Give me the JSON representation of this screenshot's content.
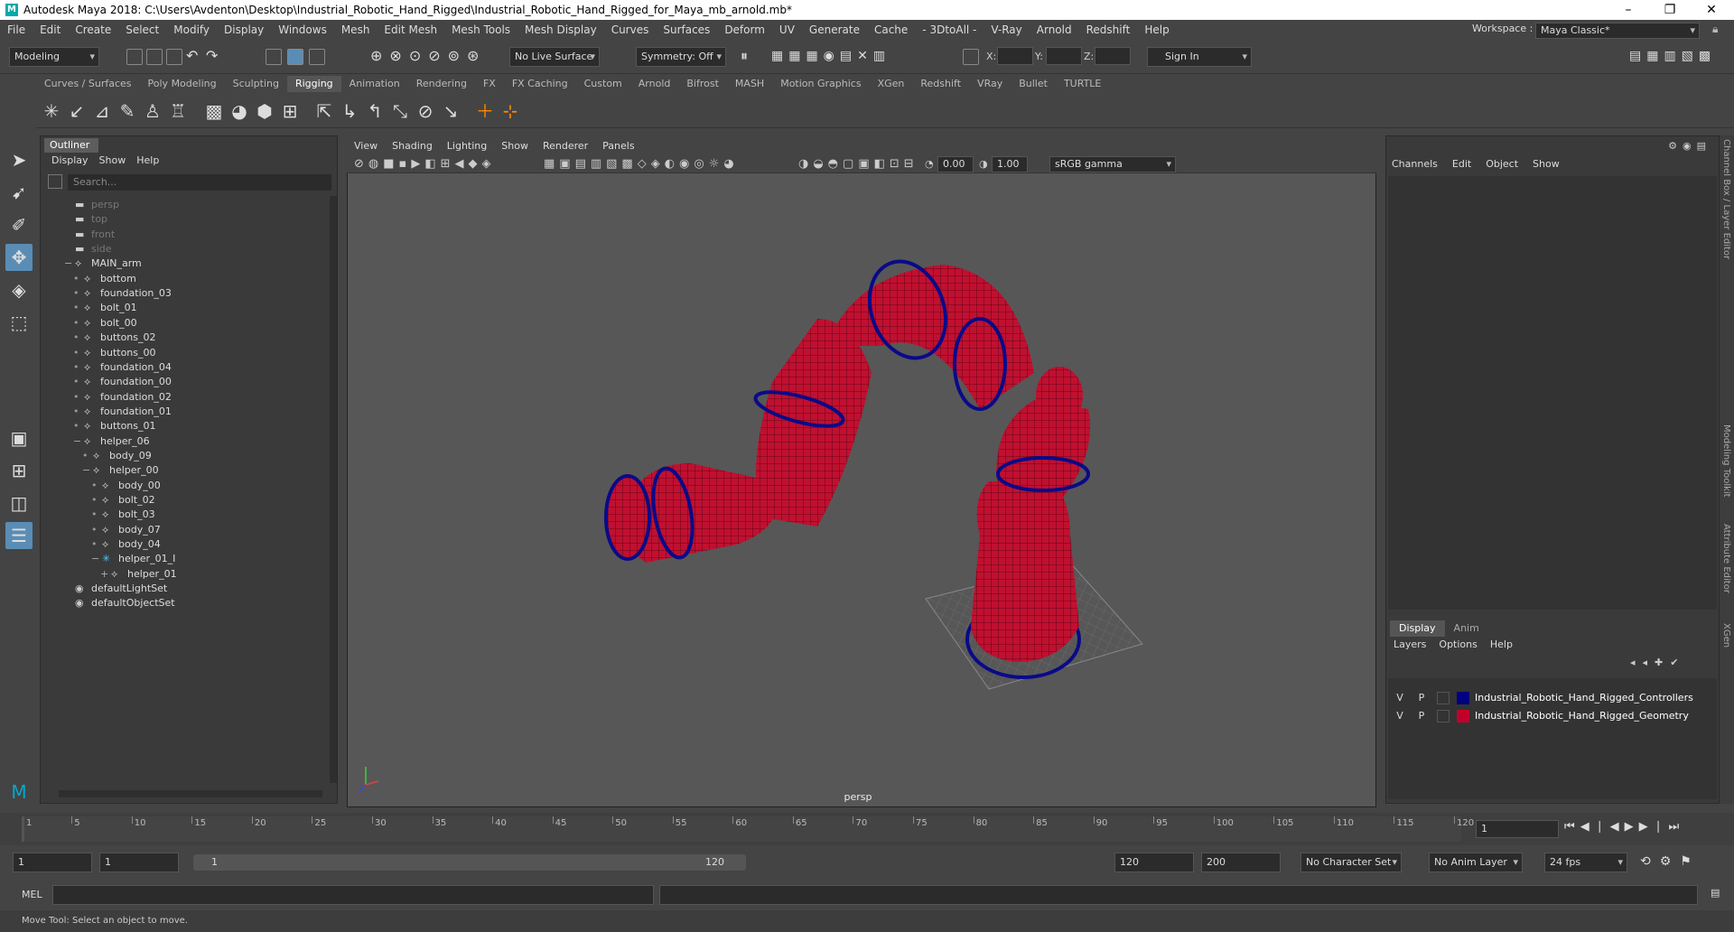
{
  "window": {
    "title": "Autodesk Maya 2018: C:\\Users\\Avdenton\\Desktop\\Industrial_Robotic_Hand_Rigged\\Industrial_Robotic_Hand_Rigged_for_Maya_mb_arnold.mb*"
  },
  "menubar": [
    "File",
    "Edit",
    "Create",
    "Select",
    "Modify",
    "Display",
    "Windows",
    "Mesh",
    "Edit Mesh",
    "Mesh Tools",
    "Mesh Display",
    "Curves",
    "Surfaces",
    "Deform",
    "UV",
    "Generate",
    "Cache",
    "- 3DtoAll -",
    "V-Ray",
    "Arnold",
    "Redshift",
    "Help"
  ],
  "workspace": {
    "label": "Workspace :",
    "value": "Maya Classic*"
  },
  "statusline": {
    "mode": "Modeling",
    "live_surface": "No Live Surface",
    "symmetry": "Symmetry: Off",
    "x_label": "X:",
    "y_label": "Y:",
    "z_label": "Z:",
    "sign_in": "Sign In"
  },
  "shelf_tabs": [
    "Curves / Surfaces",
    "Poly Modeling",
    "Sculpting",
    "Rigging",
    "Animation",
    "Rendering",
    "FX",
    "FX Caching",
    "Custom",
    "Arnold",
    "Bifrost",
    "MASH",
    "Motion Graphics",
    "XGen",
    "Redshift",
    "VRay",
    "Bullet",
    "TURTLE"
  ],
  "active_shelf": "Rigging",
  "outliner": {
    "title": "Outliner",
    "menu": [
      "Display",
      "Show",
      "Help"
    ],
    "search_placeholder": "Search...",
    "rows": [
      {
        "name": "persp",
        "depth": 0,
        "icon": "camera-icon",
        "dim": true
      },
      {
        "name": "top",
        "depth": 0,
        "icon": "camera-icon",
        "dim": true
      },
      {
        "name": "front",
        "depth": 0,
        "icon": "camera-icon",
        "dim": true
      },
      {
        "name": "side",
        "depth": 0,
        "icon": "camera-icon",
        "dim": true
      },
      {
        "name": "MAIN_arm",
        "depth": 0,
        "icon": "transform-icon",
        "expander": "−"
      },
      {
        "name": "bottom",
        "depth": 1,
        "icon": "transform-icon"
      },
      {
        "name": "foundation_03",
        "depth": 1,
        "icon": "transform-icon"
      },
      {
        "name": "bolt_01",
        "depth": 1,
        "icon": "transform-icon"
      },
      {
        "name": "bolt_00",
        "depth": 1,
        "icon": "transform-icon"
      },
      {
        "name": "buttons_02",
        "depth": 1,
        "icon": "transform-icon"
      },
      {
        "name": "buttons_00",
        "depth": 1,
        "icon": "transform-icon"
      },
      {
        "name": "foundation_04",
        "depth": 1,
        "icon": "transform-icon"
      },
      {
        "name": "foundation_00",
        "depth": 1,
        "icon": "transform-icon"
      },
      {
        "name": "foundation_02",
        "depth": 1,
        "icon": "transform-icon"
      },
      {
        "name": "foundation_01",
        "depth": 1,
        "icon": "transform-icon"
      },
      {
        "name": "buttons_01",
        "depth": 1,
        "icon": "transform-icon"
      },
      {
        "name": "helper_06",
        "depth": 1,
        "icon": "transform-icon",
        "expander": "−"
      },
      {
        "name": "body_09",
        "depth": 2,
        "icon": "transform-icon"
      },
      {
        "name": "helper_00",
        "depth": 2,
        "icon": "transform-icon",
        "expander": "−"
      },
      {
        "name": "body_00",
        "depth": 3,
        "icon": "transform-icon"
      },
      {
        "name": "bolt_02",
        "depth": 3,
        "icon": "transform-icon"
      },
      {
        "name": "bolt_03",
        "depth": 3,
        "icon": "transform-icon"
      },
      {
        "name": "body_07",
        "depth": 3,
        "icon": "transform-icon"
      },
      {
        "name": "body_04",
        "depth": 3,
        "icon": "transform-icon"
      },
      {
        "name": "helper_01_I",
        "depth": 3,
        "icon": "ik-icon",
        "expander": "−"
      },
      {
        "name": "helper_01",
        "depth": 4,
        "icon": "transform-icon",
        "expander": "+"
      },
      {
        "name": "defaultLightSet",
        "depth": 0,
        "icon": "set-icon"
      },
      {
        "name": "defaultObjectSet",
        "depth": 0,
        "icon": "set-icon"
      }
    ]
  },
  "viewport": {
    "menu": [
      "View",
      "Shading",
      "Lighting",
      "Show",
      "Renderer",
      "Panels"
    ],
    "near": "0.00",
    "far": "1.00",
    "colorspace": "sRGB gamma",
    "camera_label": "persp"
  },
  "channel_box": {
    "menu": [
      "Channels",
      "Edit",
      "Object",
      "Show"
    ]
  },
  "layer_editor": {
    "tabs": [
      "Display",
      "Anim"
    ],
    "menu": [
      "Layers",
      "Options",
      "Help"
    ],
    "layers": [
      {
        "v": "V",
        "p": "P",
        "color": "#000080",
        "name": "Industrial_Robotic_Hand_Rigged_Controllers"
      },
      {
        "v": "V",
        "p": "P",
        "color": "#c0002a",
        "name": "Industrial_Robotic_Hand_Rigged_Geometry"
      }
    ]
  },
  "side_tabs": [
    "Channel Box / Layer Editor",
    "Modeling Toolkit",
    "Attribute Editor",
    "XGen"
  ],
  "timeline": {
    "ticks": [
      1,
      5,
      10,
      15,
      20,
      25,
      30,
      35,
      40,
      45,
      50,
      55,
      60,
      65,
      70,
      75,
      80,
      85,
      90,
      95,
      100,
      105,
      110,
      115,
      120
    ],
    "current_frame": "1"
  },
  "range": {
    "start": "1",
    "anim_start": "1",
    "slider_start": "1",
    "slider_end": "120",
    "end": "120",
    "anim_end": "200",
    "character_set": "No Character Set",
    "anim_layer": "No Anim Layer",
    "fps": "24 fps"
  },
  "command_line": {
    "label": "MEL"
  },
  "help_line": "Move Tool: Select an object to move."
}
